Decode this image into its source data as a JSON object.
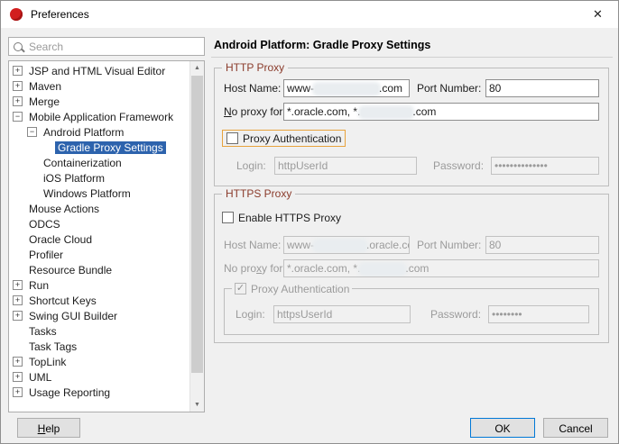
{
  "window": {
    "title": "Preferences"
  },
  "search": {
    "placeholder": "Search"
  },
  "tree": {
    "items": [
      {
        "label": "JSP and HTML Visual Editor",
        "level": 0,
        "toggle": "plus",
        "selected": false
      },
      {
        "label": "Maven",
        "level": 0,
        "toggle": "plus",
        "selected": false
      },
      {
        "label": "Merge",
        "level": 0,
        "toggle": "plus",
        "selected": false
      },
      {
        "label": "Mobile Application Framework",
        "level": 0,
        "toggle": "minus",
        "selected": false
      },
      {
        "label": "Android Platform",
        "level": 1,
        "toggle": "minus",
        "selected": false
      },
      {
        "label": "Gradle Proxy Settings",
        "level": 2,
        "toggle": "none",
        "selected": true
      },
      {
        "label": "Containerization",
        "level": 1,
        "toggle": "none",
        "selected": false
      },
      {
        "label": "iOS Platform",
        "level": 1,
        "toggle": "none",
        "selected": false
      },
      {
        "label": "Windows Platform",
        "level": 1,
        "toggle": "none",
        "selected": false
      },
      {
        "label": "Mouse Actions",
        "level": 0,
        "toggle": "none",
        "selected": false
      },
      {
        "label": "ODCS",
        "level": 0,
        "toggle": "none",
        "selected": false
      },
      {
        "label": "Oracle Cloud",
        "level": 0,
        "toggle": "none",
        "selected": false
      },
      {
        "label": "Profiler",
        "level": 0,
        "toggle": "none",
        "selected": false
      },
      {
        "label": "Resource Bundle",
        "level": 0,
        "toggle": "none",
        "selected": false
      },
      {
        "label": "Run",
        "level": 0,
        "toggle": "plus",
        "selected": false
      },
      {
        "label": "Shortcut Keys",
        "level": 0,
        "toggle": "plus",
        "selected": false
      },
      {
        "label": "Swing GUI Builder",
        "level": 0,
        "toggle": "plus",
        "selected": false
      },
      {
        "label": "Tasks",
        "level": 0,
        "toggle": "none",
        "selected": false
      },
      {
        "label": "Task Tags",
        "level": 0,
        "toggle": "none",
        "selected": false
      },
      {
        "label": "TopLink",
        "level": 0,
        "toggle": "plus",
        "selected": false
      },
      {
        "label": "UML",
        "level": 0,
        "toggle": "plus",
        "selected": false
      },
      {
        "label": "Usage Reporting",
        "level": 0,
        "toggle": "plus",
        "selected": false
      }
    ]
  },
  "content": {
    "title": "Android Platform: Gradle Proxy Settings",
    "http": {
      "group_title": "HTTP Proxy",
      "host_label": "Host Name:",
      "host_pre": "www-",
      "host_post": ".com",
      "port_label": "Port Number:",
      "port_value": "80",
      "noproxy_label": {
        "mn": "N",
        "rest": "o proxy for:"
      },
      "noproxy_pre": "*.oracle.com, *.",
      "noproxy_post": ".com",
      "auth_label": "Proxy Authentication",
      "login_label": "Login:",
      "login_value": "httpUserId",
      "password_label": "Password:",
      "password_value": "••••••••••••••"
    },
    "https": {
      "group_title": "HTTPS Proxy",
      "enable_label": "Enable HTTPS Proxy",
      "host_label": "Host Name:",
      "host_pre": "www-",
      "host_post": ".oracle.com",
      "port_label": "Port Number:",
      "port_value": "80",
      "noproxy_label": {
        "pre": "No pro",
        "mn": "x",
        "rest": "y for:"
      },
      "noproxy_pre": "*.oracle.com, *.",
      "noproxy_post": ".com",
      "auth_label": "Proxy Authentication",
      "login_label": "Login:",
      "login_value": "httpsUserId",
      "password_label": "Password:",
      "password_value": "••••••••"
    }
  },
  "buttons": {
    "help": {
      "mn": "H",
      "rest": "elp"
    },
    "ok": "OK",
    "cancel": "Cancel"
  },
  "colors": {
    "titlebar_bg": "#ffffff",
    "dialog_bg": "#f0f0f0",
    "selection_bg": "#2d63ad",
    "selection_fg": "#ffffff",
    "group_title": "#8a3b2b",
    "focus_ring": "#e8a33d",
    "default_button_border": "#0078d7",
    "app_icon": "#d21e1e"
  }
}
